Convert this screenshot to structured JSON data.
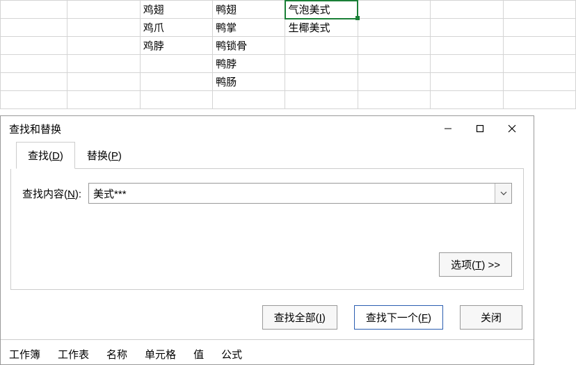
{
  "sheet": {
    "rows": [
      [
        "",
        "",
        "鸡翅",
        "鸭翅",
        "气泡美式",
        "",
        "",
        ""
      ],
      [
        "",
        "",
        "鸡爪",
        "鸭掌",
        "生椰美式",
        "",
        "",
        ""
      ],
      [
        "",
        "",
        "鸡脖",
        "鸭锁骨",
        "",
        "",
        "",
        ""
      ],
      [
        "",
        "",
        "",
        "鸭脖",
        "",
        "",
        "",
        ""
      ],
      [
        "",
        "",
        "",
        "鸭肠",
        "",
        "",
        "",
        ""
      ],
      [
        "",
        "",
        "",
        "",
        "",
        "",
        "",
        ""
      ]
    ],
    "selected": {
      "row": 0,
      "col": 4
    }
  },
  "dialog": {
    "title": "查找和替换",
    "tabs": {
      "find": "查找(D)",
      "replace": "替换(P)"
    },
    "find_label": "查找内容(N):",
    "find_value": "美式***",
    "options_label": "选项(T) >>",
    "buttons": {
      "find_all": "查找全部(I)",
      "find_next": "查找下一个(F)",
      "close": "关闭"
    },
    "results_cols": [
      "工作簿",
      "工作表",
      "名称",
      "单元格",
      "值",
      "公式"
    ]
  }
}
